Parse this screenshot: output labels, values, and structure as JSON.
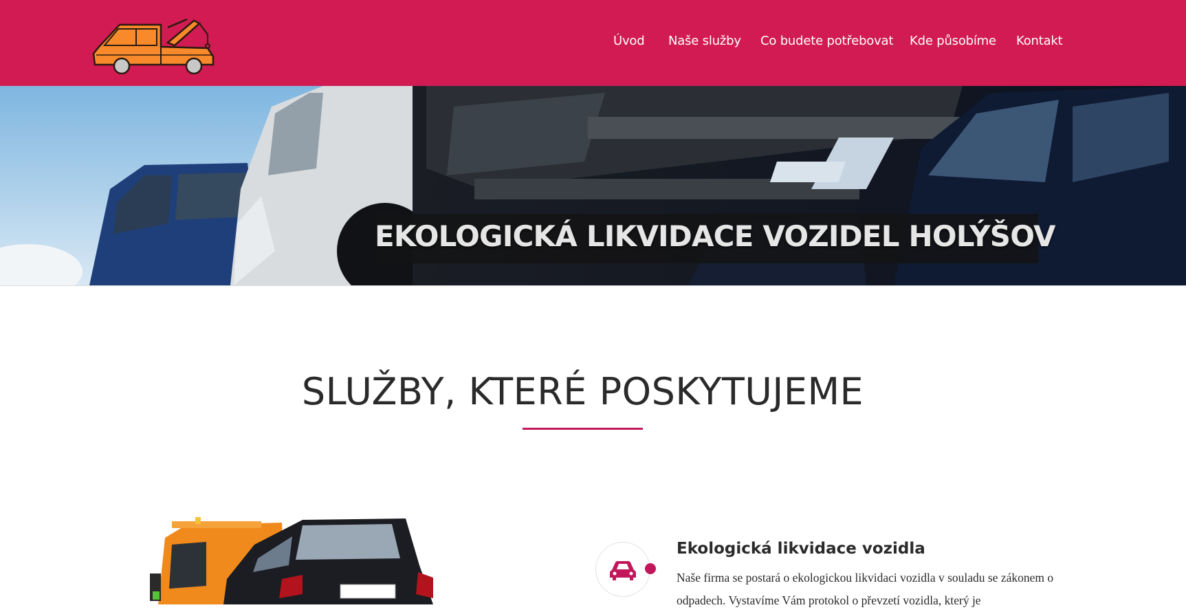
{
  "header": {
    "logo_alt": "tow-truck-logo",
    "nav": [
      {
        "label": "Úvod"
      },
      {
        "label": "Naše služby"
      },
      {
        "label": "Co budete potřebovat"
      },
      {
        "label": "Kde působíme"
      },
      {
        "label": "Kontakt"
      }
    ],
    "colors": {
      "background": "#d11b52",
      "text": "#ffffff"
    }
  },
  "hero": {
    "title": "EKOLOGICKÁ LIKVIDACE VOZIDEL HOLÝŠOV"
  },
  "section": {
    "title": "SLUŽBY, KTERÉ POSKYTUJEME",
    "accent": "#c2185b"
  },
  "service": {
    "icon": "car-icon",
    "title": "Ekologická likvidace vozidla",
    "text": "Naše firma se postará o ekologickou likvidaci vozidla v souladu se zákonem o odpadech. Vystavíme Vám protokol o převzetí vozidla, který je"
  }
}
